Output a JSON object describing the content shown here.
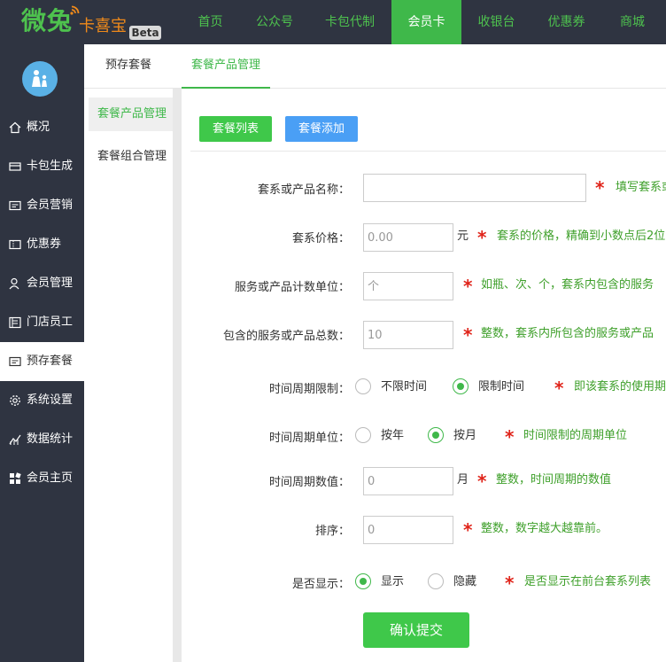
{
  "logo": {
    "brand_main": "微兔",
    "brand_sub": "卡喜宝",
    "beta": "Beta"
  },
  "topnav": {
    "items": [
      {
        "label": "首页"
      },
      {
        "label": "公众号"
      },
      {
        "label": "卡包代制"
      },
      {
        "label": "会员卡"
      },
      {
        "label": "收银台"
      },
      {
        "label": "优惠券"
      },
      {
        "label": "商城"
      }
    ],
    "active": "会员卡"
  },
  "sidebar": {
    "items": [
      {
        "label": "概况",
        "icon": "home-icon"
      },
      {
        "label": "卡包生成",
        "icon": "card-icon"
      },
      {
        "label": "会员营销",
        "icon": "marketing-icon"
      },
      {
        "label": "优惠券",
        "icon": "coupon-icon"
      },
      {
        "label": "会员管理",
        "icon": "user-icon"
      },
      {
        "label": "门店员工",
        "icon": "store-icon"
      },
      {
        "label": "预存套餐",
        "icon": "package-icon"
      },
      {
        "label": "系统设置",
        "icon": "gear-icon"
      },
      {
        "label": "数据统计",
        "icon": "chart-icon"
      },
      {
        "label": "会员主页",
        "icon": "grid-icon"
      }
    ],
    "active": "预存套餐"
  },
  "subheader": {
    "tabs": [
      {
        "label": "预存套餐"
      },
      {
        "label": "套餐产品管理"
      }
    ],
    "active": "套餐产品管理"
  },
  "subnav": {
    "items": [
      {
        "label": "套餐产品管理"
      },
      {
        "label": "套餐组合管理"
      }
    ],
    "active": "套餐产品管理"
  },
  "actions": {
    "list": "套餐列表",
    "add": "套餐添加"
  },
  "form": {
    "name": {
      "label": "套系或产品名称：",
      "value": "",
      "hint": "填写套系或"
    },
    "price": {
      "label": "套系价格：",
      "placeholder": "0.00",
      "unit": "元",
      "hint": "套系的价格，精确到小数点后2位"
    },
    "unit": {
      "label": "服务或产品计数单位：",
      "placeholder": "个",
      "hint": "如瓶、次、个，套系内包含的服务"
    },
    "total": {
      "label": "包含的服务或产品总数：",
      "placeholder": "10",
      "hint": "整数，套系内所包含的服务或产品"
    },
    "time_limit": {
      "label": "时间周期限制：",
      "options": [
        "不限时间",
        "限制时间"
      ],
      "selected": "限制时间",
      "hint": "即该套系的使用期"
    },
    "time_unit": {
      "label": "时间周期单位：",
      "options": [
        "按年",
        "按月"
      ],
      "selected": "按月",
      "hint": "时间限制的周期单位"
    },
    "time_value": {
      "label": "时间周期数值：",
      "placeholder": "0",
      "unit": "月",
      "hint": "整数，时间周期的数值"
    },
    "sort": {
      "label": "排序：",
      "placeholder": "0",
      "hint": "整数，数字越大越靠前。"
    },
    "display": {
      "label": "是否显示：",
      "options": [
        "显示",
        "隐藏"
      ],
      "selected": "显示",
      "hint": "是否显示在前台套系列表"
    },
    "submit": "确认提交"
  },
  "colors": {
    "accent_green": "#3fb84a",
    "hint_green": "#3fa02b",
    "blue_button": "#4a9ff5",
    "dark_bg": "#2f3441",
    "required_star": "#e0241a"
  }
}
